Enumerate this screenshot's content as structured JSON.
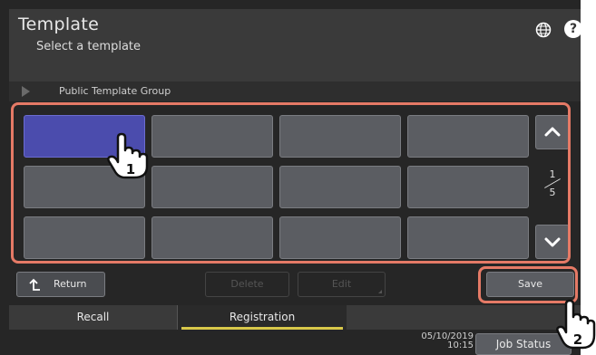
{
  "header": {
    "title": "Template",
    "subtitle": "Select a template"
  },
  "group": {
    "label": "Public Template Group"
  },
  "grid": {
    "selected_index": 0,
    "tile_count": 12
  },
  "pager": {
    "current": "1",
    "total": "5"
  },
  "buttons": {
    "return": "Return",
    "delete": "Delete",
    "edit": "Edit",
    "save": "Save"
  },
  "tabs": {
    "recall": "Recall",
    "registration": "Registration"
  },
  "status": {
    "date": "05/10/2019",
    "time": "10:15",
    "job_status": "Job Status"
  },
  "callouts": {
    "step1": "1",
    "step2": "2"
  },
  "colors": {
    "highlight": "#e57a66",
    "selected_tile": "#4b4cad",
    "tab_accent": "#d8c84a"
  }
}
